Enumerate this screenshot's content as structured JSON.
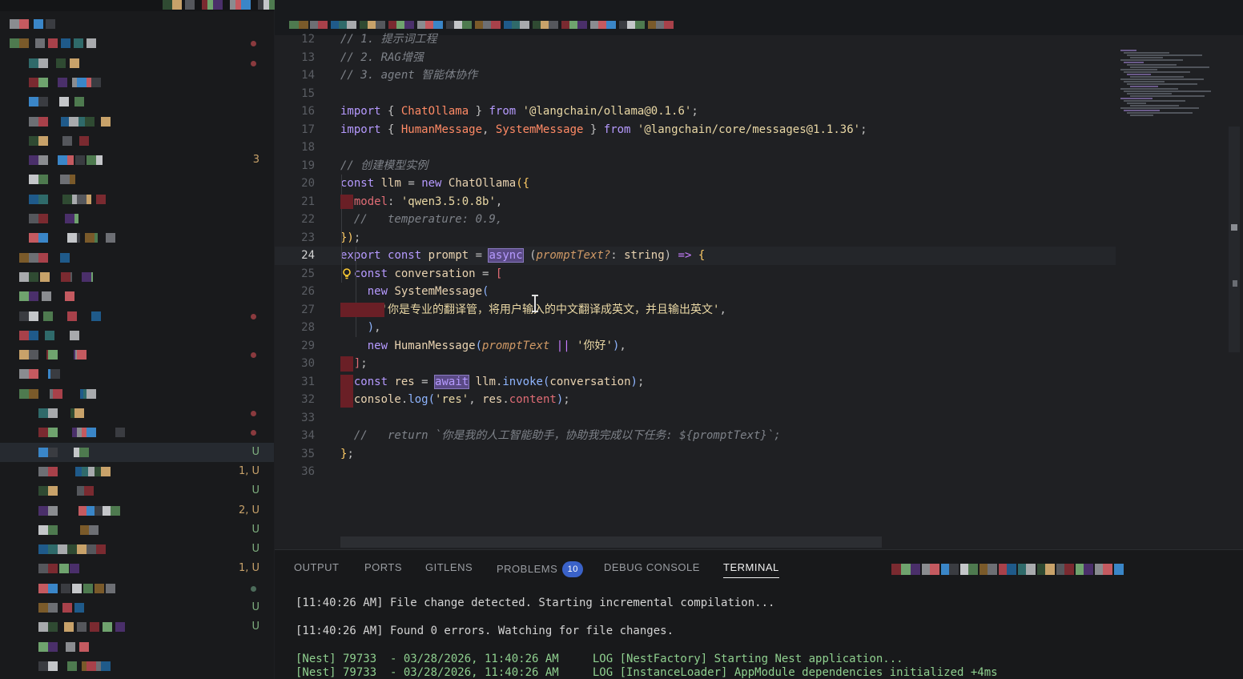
{
  "editor": {
    "lines": [
      {
        "n": "12",
        "segs": [
          [
            "t-com",
            "// 1. 提示词工程"
          ]
        ]
      },
      {
        "n": "13",
        "segs": [
          [
            "t-com",
            "// 2. RAG增强"
          ]
        ]
      },
      {
        "n": "14",
        "segs": [
          [
            "t-com",
            "// 3. agent 智能体协作"
          ]
        ]
      },
      {
        "n": "15",
        "segs": []
      },
      {
        "n": "16",
        "segs": [
          [
            "t-kw2",
            "import"
          ],
          [
            "t-punc",
            " { "
          ],
          [
            "t-imp",
            "ChatOllama"
          ],
          [
            "t-punc",
            " } "
          ],
          [
            "t-kw2",
            "from"
          ],
          [
            "t-punc",
            " "
          ],
          [
            "t-str2",
            "'@langchain/ollama@0.1.6'"
          ],
          [
            "t-punc",
            ";"
          ]
        ]
      },
      {
        "n": "17",
        "segs": [
          [
            "t-kw2",
            "import"
          ],
          [
            "t-punc",
            " { "
          ],
          [
            "t-imp",
            "HumanMessage"
          ],
          [
            "t-punc",
            ", "
          ],
          [
            "t-imp",
            "SystemMessage"
          ],
          [
            "t-punc",
            " } "
          ],
          [
            "t-kw2",
            "from"
          ],
          [
            "t-punc",
            " "
          ],
          [
            "t-str2",
            "'@langchain/core/messages@1.1.36'"
          ],
          [
            "t-punc",
            ";"
          ]
        ]
      },
      {
        "n": "18",
        "segs": []
      },
      {
        "n": "19",
        "segs": [
          [
            "t-com",
            "// 创建模型实例"
          ]
        ]
      },
      {
        "n": "20",
        "segs": [
          [
            "t-kw2",
            "const"
          ],
          [
            "t-punc",
            " "
          ],
          [
            "t-cls",
            "llm"
          ],
          [
            "t-punc",
            " = "
          ],
          [
            "t-kw2",
            "new"
          ],
          [
            "t-punc",
            " "
          ],
          [
            "t-cls",
            "ChatOllama"
          ],
          [
            "t-yel",
            "({"
          ]
        ]
      },
      {
        "n": "21",
        "segs": [
          [
            "t-punc",
            "  "
          ],
          [
            "t-prop",
            "model"
          ],
          [
            "t-punc",
            ": "
          ],
          [
            "t-str2",
            "'qwen3.5:0.8b'"
          ],
          [
            "t-punc",
            ","
          ]
        ]
      },
      {
        "n": "22",
        "segs": [
          [
            "t-com",
            "  //   temperature: 0.9,"
          ]
        ]
      },
      {
        "n": "23",
        "segs": [
          [
            "t-yel",
            "})"
          ],
          [
            "t-punc",
            ";"
          ]
        ]
      },
      {
        "n": "24",
        "segs": [
          [
            "t-kw2",
            "export"
          ],
          [
            "t-punc",
            " "
          ],
          [
            "t-kw2",
            "const"
          ],
          [
            "t-punc",
            " "
          ],
          [
            "t-cls",
            "prompt"
          ],
          [
            "t-punc",
            " = "
          ],
          [
            "t-kw2 hl",
            "async"
          ],
          [
            "t-punc",
            " ("
          ],
          [
            "t-param",
            "promptText?"
          ],
          [
            "t-punc",
            ": "
          ],
          [
            "t-cls",
            "string"
          ],
          [
            "t-punc",
            ") "
          ],
          [
            "t-op",
            "=>"
          ],
          [
            "t-punc",
            " "
          ],
          [
            "t-yel",
            "{"
          ]
        ]
      },
      {
        "n": "25",
        "segs": [
          [
            "t-punc",
            "  "
          ],
          [
            "t-kw2",
            "const"
          ],
          [
            "t-punc",
            " "
          ],
          [
            "t-cls",
            "conversation"
          ],
          [
            "t-punc",
            " = "
          ],
          [
            "t-prop",
            "["
          ]
        ]
      },
      {
        "n": "26",
        "segs": [
          [
            "t-punc",
            "    "
          ],
          [
            "t-kw2",
            "new"
          ],
          [
            "t-punc",
            " "
          ],
          [
            "t-cls",
            "SystemMessage"
          ],
          [
            "t-fn",
            "("
          ]
        ]
      },
      {
        "n": "27",
        "segs": [
          [
            "t-punc",
            "      "
          ],
          [
            "t-str2",
            "'你是专业的翻译管，将用户输入的中文翻译成英文，并且输出英文'"
          ],
          [
            "t-punc",
            ","
          ]
        ]
      },
      {
        "n": "28",
        "segs": [
          [
            "t-punc",
            "    "
          ],
          [
            "t-fn",
            ")"
          ],
          [
            "t-punc",
            ","
          ]
        ]
      },
      {
        "n": "29",
        "segs": [
          [
            "t-punc",
            "    "
          ],
          [
            "t-kw2",
            "new"
          ],
          [
            "t-punc",
            " "
          ],
          [
            "t-cls",
            "HumanMessage"
          ],
          [
            "t-fn",
            "("
          ],
          [
            "t-param",
            "promptText"
          ],
          [
            "t-punc",
            " "
          ],
          [
            "t-op",
            "||"
          ],
          [
            "t-punc",
            " "
          ],
          [
            "t-str2",
            "'你好'"
          ],
          [
            "t-fn",
            ")"
          ],
          [
            "t-punc",
            ","
          ]
        ]
      },
      {
        "n": "30",
        "segs": [
          [
            "t-punc",
            "  "
          ],
          [
            "t-prop",
            "]"
          ],
          [
            "t-punc",
            ";"
          ]
        ]
      },
      {
        "n": "31",
        "segs": [
          [
            "t-punc",
            "  "
          ],
          [
            "t-kw2",
            "const"
          ],
          [
            "t-punc",
            " "
          ],
          [
            "t-cls",
            "res"
          ],
          [
            "t-punc",
            " = "
          ],
          [
            "t-kw2 hl",
            "await"
          ],
          [
            "t-punc",
            " "
          ],
          [
            "t-cls",
            "llm"
          ],
          [
            "t-punc",
            "."
          ],
          [
            "t-fn",
            "invoke"
          ],
          [
            "t-fn",
            "("
          ],
          [
            "t-cls",
            "conversation"
          ],
          [
            "t-fn",
            ")"
          ],
          [
            "t-punc",
            ";"
          ]
        ]
      },
      {
        "n": "32",
        "segs": [
          [
            "t-punc",
            "  "
          ],
          [
            "t-cls",
            "console"
          ],
          [
            "t-punc",
            "."
          ],
          [
            "t-fn",
            "log"
          ],
          [
            "t-fn",
            "("
          ],
          [
            "t-str2",
            "'res'"
          ],
          [
            "t-punc",
            ", "
          ],
          [
            "t-cls",
            "res"
          ],
          [
            "t-punc",
            "."
          ],
          [
            "t-prop",
            "content"
          ],
          [
            "t-fn",
            ")"
          ],
          [
            "t-punc",
            ";"
          ]
        ]
      },
      {
        "n": "33",
        "segs": []
      },
      {
        "n": "34",
        "segs": [
          [
            "t-com",
            "  //   return `你是我的人工智能助手，协助我完成以下任务: ${promptText}`;"
          ]
        ]
      },
      {
        "n": "35",
        "segs": [
          [
            "t-yel",
            "}"
          ],
          [
            "t-punc",
            ";"
          ]
        ]
      },
      {
        "n": "36",
        "segs": []
      }
    ],
    "active_line": "24"
  },
  "sidebar": {
    "badges": [
      {
        "row": 7,
        "text": "3",
        "kind": "err"
      },
      {
        "row": 22,
        "text": "U",
        "kind": "git"
      },
      {
        "row": 23,
        "text": "1, U",
        "kind": "err"
      },
      {
        "row": 24,
        "text": "U",
        "kind": "git"
      },
      {
        "row": 25,
        "text": "2, U",
        "kind": "err"
      },
      {
        "row": 26,
        "text": "U",
        "kind": "git"
      },
      {
        "row": 27,
        "text": "U",
        "kind": "git"
      },
      {
        "row": 28,
        "text": "1, U",
        "kind": "err"
      },
      {
        "row": 30,
        "text": "U",
        "kind": "git"
      },
      {
        "row": 31,
        "text": "U",
        "kind": "git"
      }
    ]
  },
  "panel": {
    "tabs": [
      {
        "label": "OUTPUT",
        "active": false
      },
      {
        "label": "PORTS",
        "active": false
      },
      {
        "label": "GITLENS",
        "active": false
      },
      {
        "label": "PROBLEMS",
        "active": false,
        "badge": "10"
      },
      {
        "label": "DEBUG CONSOLE",
        "active": false
      },
      {
        "label": "TERMINAL",
        "active": true
      }
    ],
    "terminal": [
      "[11:40:26 AM] File change detected. Starting incremental compilation...",
      "",
      "[11:40:26 AM] Found 0 errors. Watching for file changes.",
      "",
      "[Nest] 79733  - 03/28/2026, 11:40:26 AM     LOG [NestFactory] Starting Nest application...",
      "[Nest] 79733  - 03/28/2026, 11:40:26 AM     LOG [InstanceLoader] AppModule dependencies initialized +4ms"
    ]
  },
  "colors": {
    "accent": "#3a62c9",
    "editor_bg": "#1f2023",
    "sidebar_bg": "#191a1c",
    "error_mark": "#6a1f26"
  }
}
